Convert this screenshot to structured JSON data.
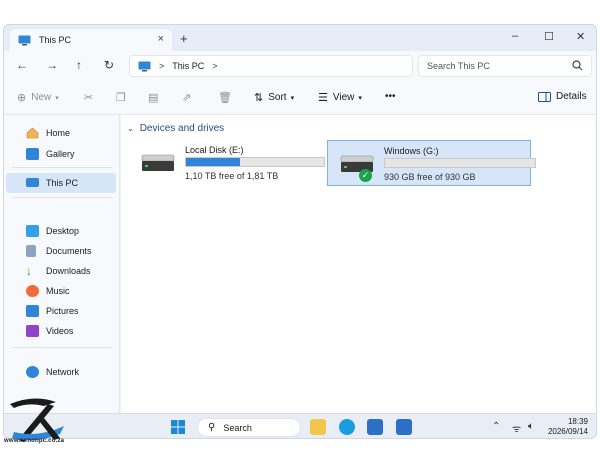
{
  "tab": {
    "title": "This PC",
    "close": "×",
    "new_tab": "+"
  },
  "window_controls": {
    "minimize": "–",
    "maximize": "☐",
    "close": "✕"
  },
  "nav": {
    "back": "←",
    "forward": "→",
    "up": "↑",
    "refresh": "↻"
  },
  "address": {
    "location": "This PC",
    "sep": ">",
    "trail": ">"
  },
  "search": {
    "placeholder": "Search This PC"
  },
  "toolbar": {
    "new_label": "New",
    "sort_label": "Sort",
    "view_label": "View",
    "more_label": "•••",
    "details_label": "Details"
  },
  "sidebar": {
    "items": [
      {
        "label": "Home"
      },
      {
        "label": "Gallery"
      },
      {
        "label": "This PC"
      },
      {
        "label": "Desktop"
      },
      {
        "label": "Documents"
      },
      {
        "label": "Downloads"
      },
      {
        "label": "Music"
      },
      {
        "label": "Pictures"
      },
      {
        "label": "Videos"
      },
      {
        "label": "Network"
      }
    ]
  },
  "main": {
    "section_title": "Devices and drives",
    "drives": [
      {
        "name": "Local Disk (E:)",
        "free_text": "1,10 TB free of 1,81 TB",
        "used_fraction": 0.39
      },
      {
        "name": "Windows (G:)",
        "free_text": "930 GB free of 930 GB",
        "used_fraction": 0.0
      }
    ]
  },
  "taskbar": {
    "search_label": "Search",
    "time": "18:39",
    "date": "2026/09/14",
    "tray_up": "⌃"
  },
  "watermark": {
    "text": "www.xenonpc.co.za"
  },
  "colors": {
    "accent": "#2f86d6",
    "selection": "#d6e5f7",
    "section": "#1f4e8c",
    "ok": "#1aa34a"
  }
}
